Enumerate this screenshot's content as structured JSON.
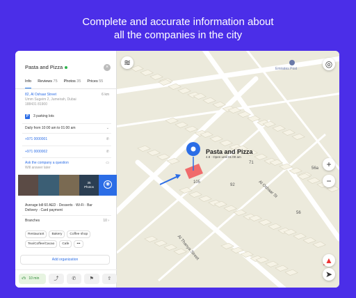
{
  "headline": {
    "line1": "Complete and accurate information about",
    "line2": "all the companies in the city"
  },
  "sidebar": {
    "title": "Pasta and Pizza",
    "close_icon": "close-icon",
    "tabs": [
      {
        "label": "Info",
        "count": ""
      },
      {
        "label": "Reviews",
        "count": "75"
      },
      {
        "label": "Photos",
        "count": "35"
      },
      {
        "label": "Prices",
        "count": "55"
      }
    ],
    "address": {
      "street": "82, Al Oshaar Street",
      "distance": "6 km",
      "line2": "Umm Sugeim 2, Jumeirah, Dubai",
      "line3": "188431 81900"
    },
    "parking": {
      "badge": "P",
      "text": "3 parking lots"
    },
    "hours": {
      "text": "Daily from 10:00 am to 01:00 am"
    },
    "phones": [
      "+971 0000001",
      "+971 0000002"
    ],
    "question": {
      "text": "Ask the company a question",
      "sub": "Will answer later"
    },
    "photos_overlay": {
      "count": "35",
      "label": "Photos"
    },
    "features": {
      "line1": "Average bill 60 AED · Desserts · Wi-Fi · Bar",
      "line2": "Delivery · Card payment"
    },
    "branches": {
      "label": "Branches",
      "count": "10"
    },
    "categories": [
      "Restaurant",
      "Bakery",
      "Coffee shop",
      "Tea/Coffee/Cacao",
      "Cafe",
      "•••"
    ],
    "add_org": "Add organization",
    "bottom": {
      "route_time": "10 min",
      "car_icon": "car-icon",
      "share_icons": [
        "route-icon",
        "phone-icon",
        "bookmark-icon",
        "share-icon"
      ]
    }
  },
  "map": {
    "callout_title": "Pasta and Pizza",
    "callout_sub": "4.8 · Open until 01:00 am",
    "street1": "Al Thanya Street",
    "street2": "Al Oshaar St",
    "poi": "Emirates Post",
    "building_numbers": [
      "105",
      "71",
      "56a",
      "92",
      "56"
    ],
    "zoom_in": "+",
    "zoom_out": "−",
    "colors": {
      "accent": "#2b6de6",
      "highlight": "#f06b6b",
      "road": "#ffffff",
      "building": "#f4f1e3"
    }
  }
}
